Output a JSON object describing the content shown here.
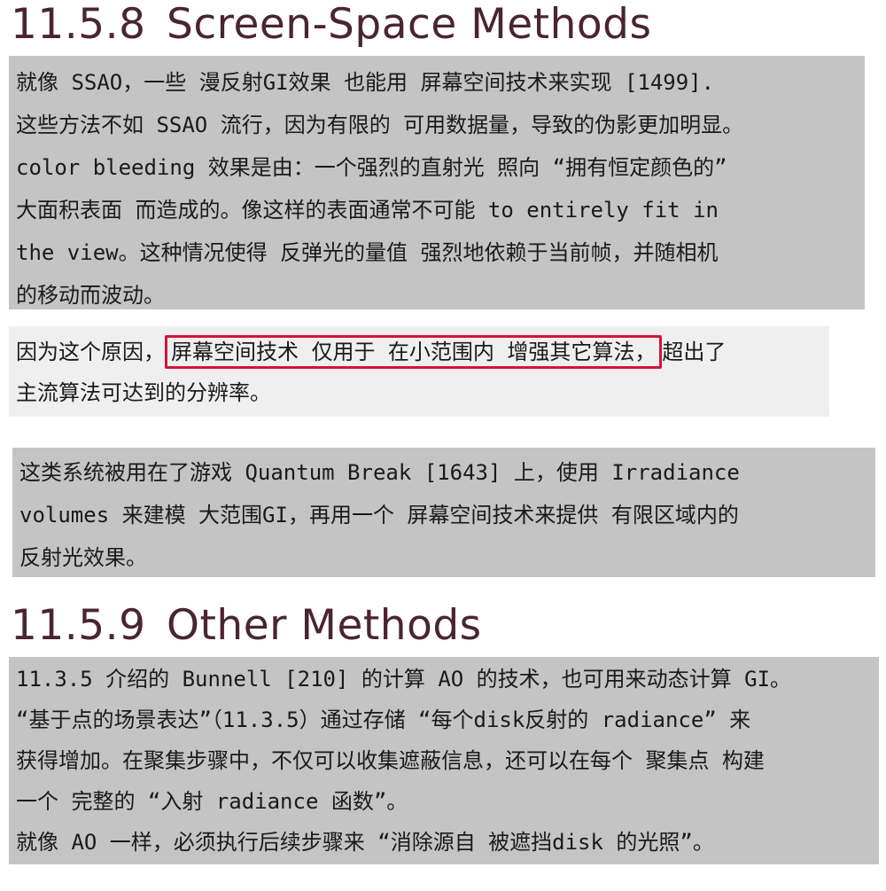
{
  "section1": {
    "number": "11.5.8",
    "title": "Screen-Space Methods",
    "para1_lines": [
      "就像 SSAO，一些 漫反射GI效果 也能用 屏幕空间技术来实现 [1499].",
      "这些方法不如 SSAO 流行，因为有限的 可用数据量，导致的伪影更加明显。",
      "color bleeding 效果是由：一个强烈的直射光 照向 “拥有恒定颜色的”",
      "大面积表面 而造成的。像这样的表面通常不可能 to entirely fit in",
      "the view。这种情况使得 反弹光的量值 强烈地依赖于当前帧，并随相机",
      "的移动而波动。"
    ],
    "para2": {
      "line1_before": "因为这个原因，",
      "line1_highlight": "屏幕空间技术 仅用于 在小范围内 增强其它算法，",
      "line1_after": "超出了",
      "line2": "主流算法可达到的分辨率。"
    },
    "para3_lines": [
      "这类系统被用在了游戏 Quantum Break [1643] 上，使用 Irradiance",
      "volumes 来建模 大范围GI，再用一个 屏幕空间技术来提供 有限区域内的",
      "反射光效果。"
    ]
  },
  "section2": {
    "number": "11.5.9",
    "title": "Other Methods",
    "para_lines": [
      "11.3.5 介绍的 Bunnell [210] 的计算 AO 的技术，也可用来动态计算 GI。",
      "“基于点的场景表达”（11.3.5）通过存储 “每个disk反射的 radiance” 来",
      "获得增加。在聚集步骤中，不仅可以收集遮蔽信息，还可以在每个 聚集点 构建",
      "一个 完整的 “入射 radiance 函数”。",
      "就像 AO 一样，必须执行后续步骤来 “消除源自 被遮挡disk 的光照”。"
    ]
  },
  "colors": {
    "heading": "#4a2530",
    "highlight_border": "#d2143a",
    "block_gray": "#c4c4c4",
    "block_light": "#efefef"
  }
}
